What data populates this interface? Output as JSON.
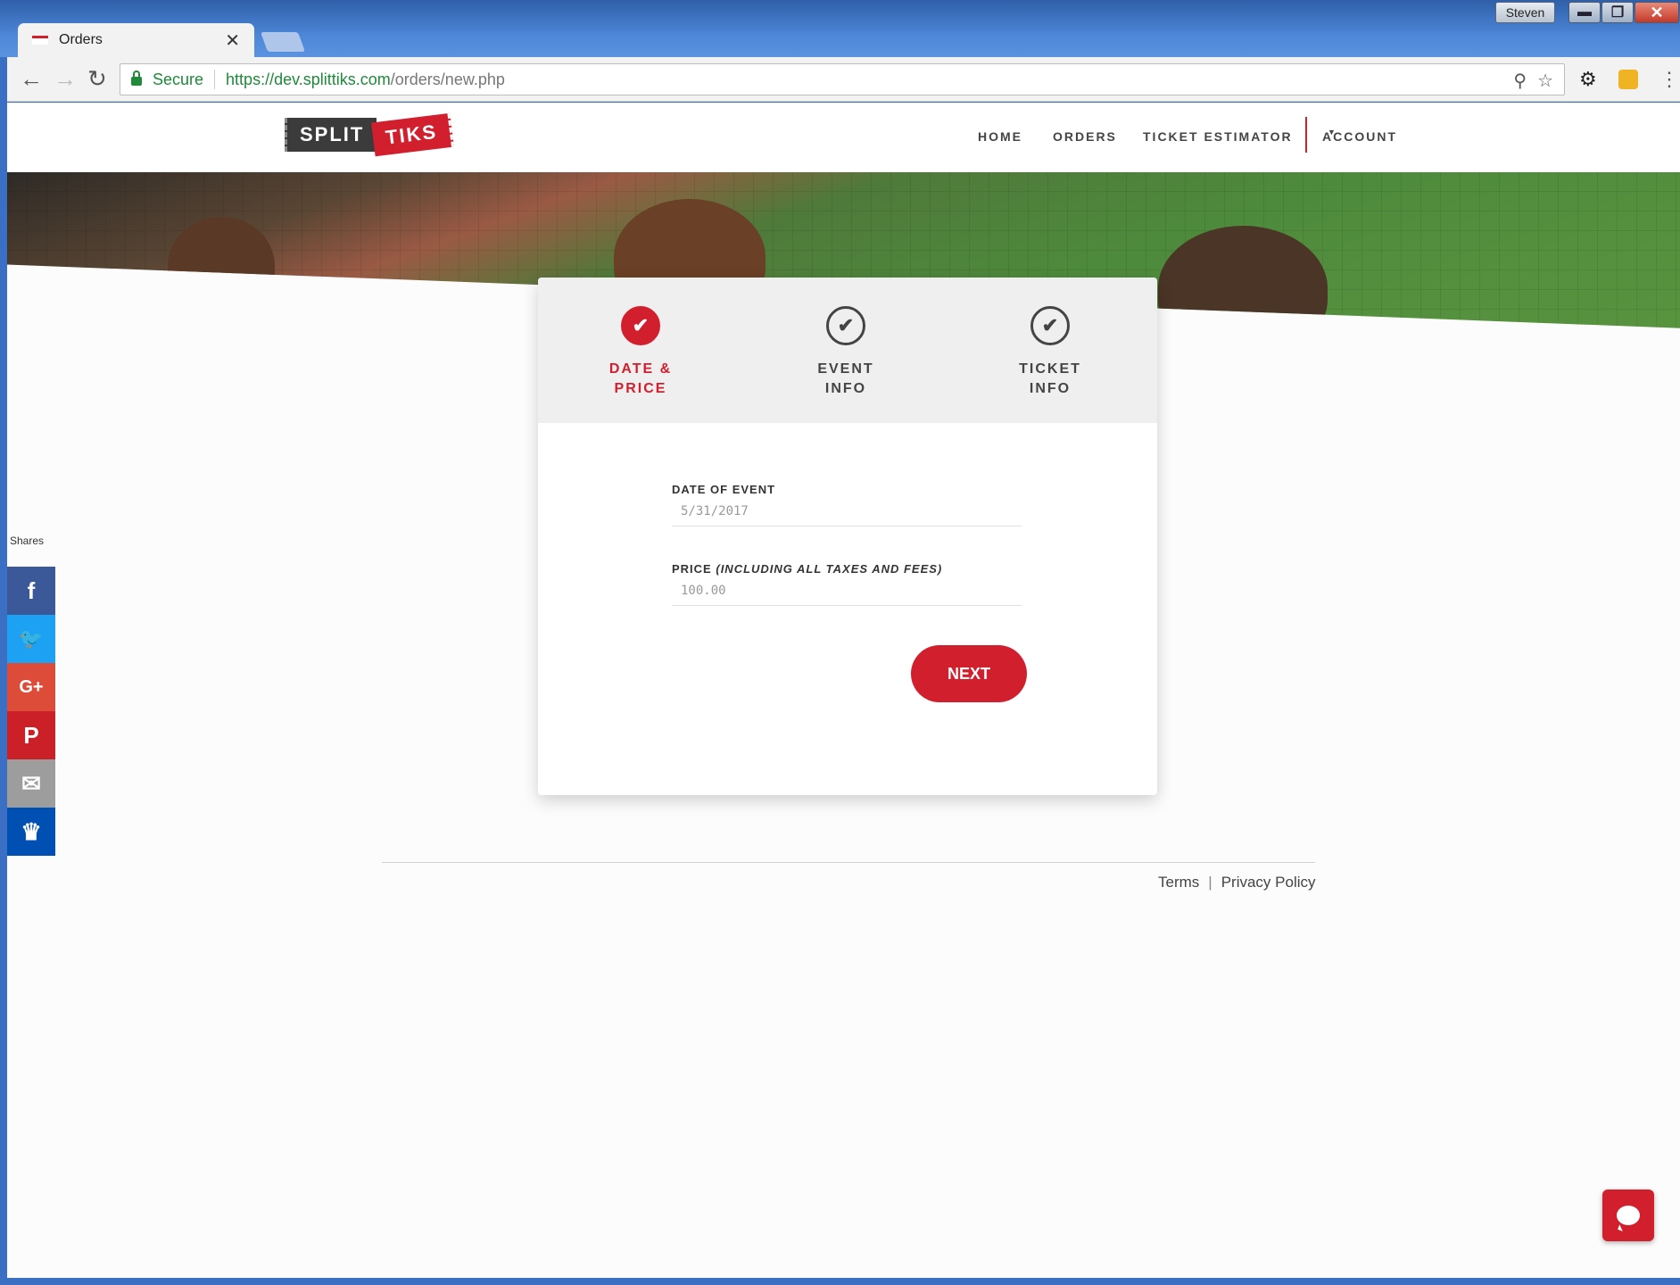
{
  "window": {
    "user": "Steven",
    "minimize": "▬",
    "maximize": "❐",
    "close": "✕"
  },
  "browser": {
    "tab_title": "Orders",
    "tab_close": "✕",
    "secure_label": "Secure",
    "url_host": "https://dev.splittiks.com",
    "url_path": "/orders/new.php",
    "back": "←",
    "forward": "→",
    "reload": "↻",
    "zoom": "⚲",
    "star": "☆",
    "settings_ext": "⚙",
    "menu": "⋮"
  },
  "logo": {
    "part1": "SPLIT",
    "part2": "TIKS"
  },
  "nav": {
    "home": "HOME",
    "orders": "ORDERS",
    "estimator": "TICKET ESTIMATOR",
    "account": "ACCOUNT",
    "account_caret": "▼"
  },
  "steps": [
    {
      "line1": "DATE &",
      "line2": "PRICE",
      "icon": "✔"
    },
    {
      "line1": "EVENT",
      "line2": "INFO",
      "icon": "✔"
    },
    {
      "line1": "TICKET",
      "line2": "INFO",
      "icon": "✔"
    }
  ],
  "form": {
    "date_label": "DATE OF EVENT",
    "date_value": "5/31/2017",
    "price_label": "PRICE",
    "price_note": "(INCLUDING ALL TAXES AND FEES)",
    "price_value": "100.00",
    "next_button": "NEXT"
  },
  "footer": {
    "terms": "Terms",
    "separator": "|",
    "privacy": "Privacy Policy"
  },
  "share": {
    "title": "Shares",
    "facebook": "f",
    "twitter": "🐦",
    "googleplus": "G+",
    "pinterest": "P",
    "email": "✉",
    "sumo": "♛"
  },
  "colors": {
    "brand_red": "#d11f2e",
    "facebook": "#3b5998",
    "twitter": "#1da1f2",
    "googleplus": "#dd4b39",
    "pinterest": "#cb2027",
    "email": "#9d9d9d",
    "sumo": "#0050b3"
  }
}
